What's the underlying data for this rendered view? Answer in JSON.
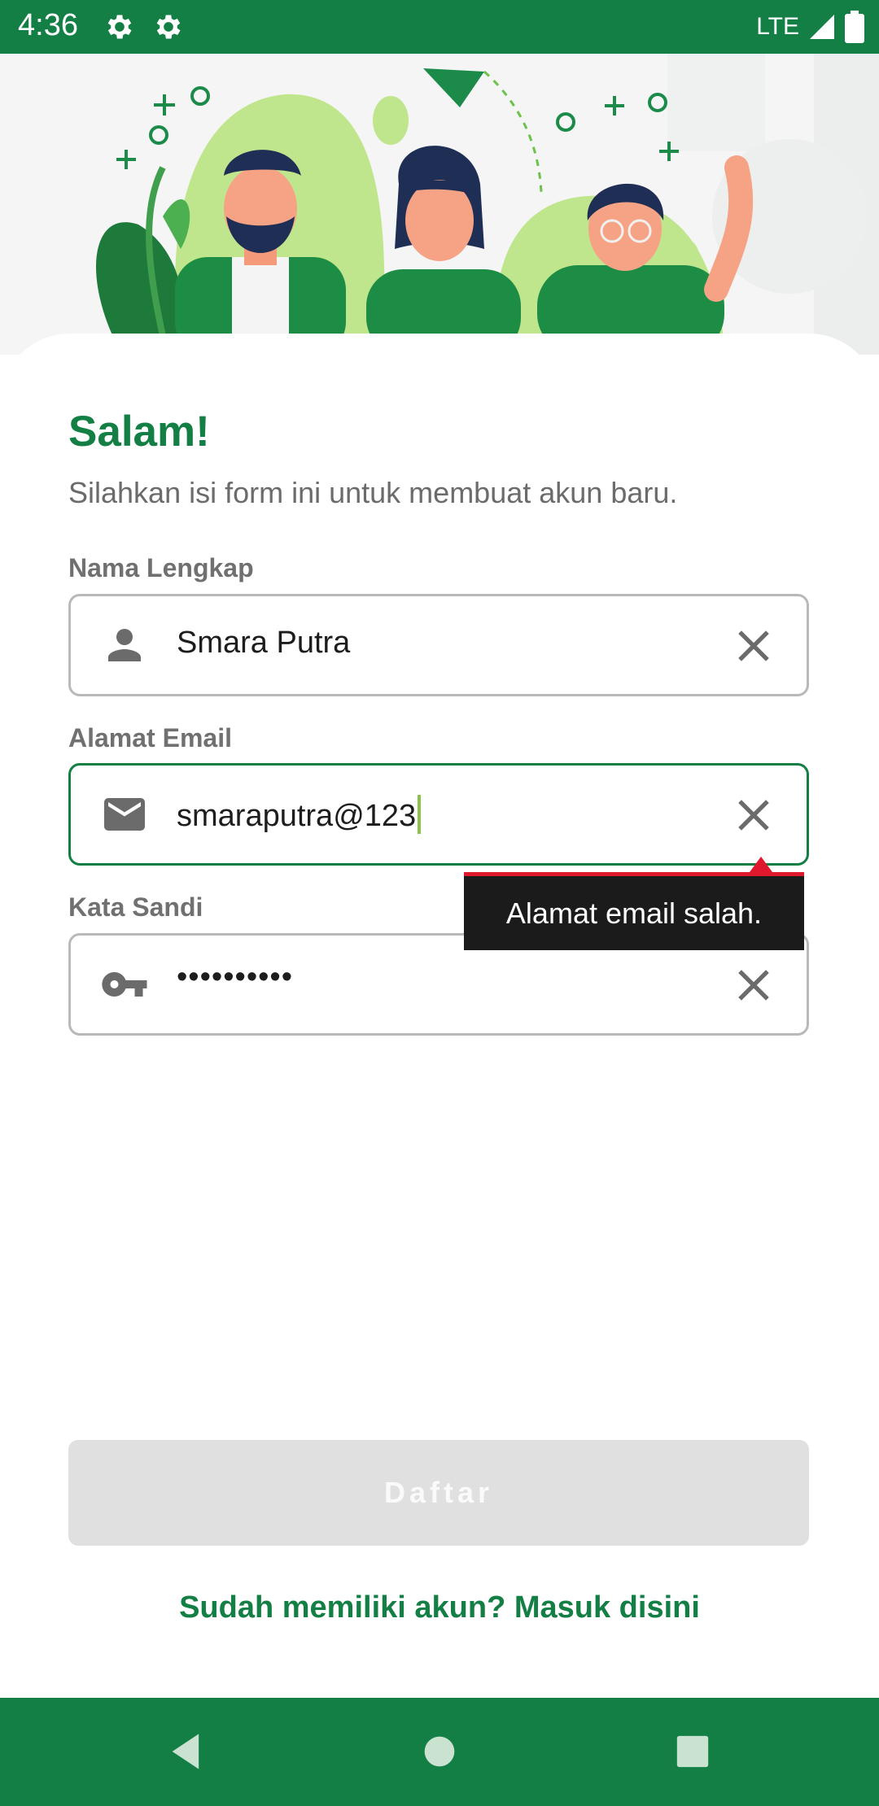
{
  "status_bar": {
    "time": "4:36",
    "network": "LTE",
    "icons": [
      "settings-icon",
      "settings-icon",
      "signal-icon",
      "battery-icon"
    ]
  },
  "form": {
    "title": "Salam!",
    "subtitle": "Silahkan isi form ini untuk membuat akun baru.",
    "fields": [
      {
        "label": "Nama Lengkap",
        "value": "Smara Putra",
        "icon": "person-icon",
        "clear_icon": "close-icon"
      },
      {
        "label": "Alamat Email",
        "value": "smaraputra@123",
        "icon": "email-icon",
        "clear_icon": "close-icon",
        "focused": true
      },
      {
        "label": "Kata Sandi",
        "value": "••••••••••",
        "icon": "key-icon",
        "clear_icon": "close-icon"
      }
    ],
    "error_message": "Alamat email salah.",
    "submit_label": "Daftar",
    "login_link": "Sudah memiliki akun? Masuk disini"
  },
  "colors": {
    "brand": "#137f44",
    "error": "#e0182d",
    "disabled_button": "#e0e0e0",
    "cursor": "#8bc34a"
  },
  "nav_bar": {
    "buttons": [
      "back-icon",
      "home-icon",
      "recents-icon"
    ]
  }
}
